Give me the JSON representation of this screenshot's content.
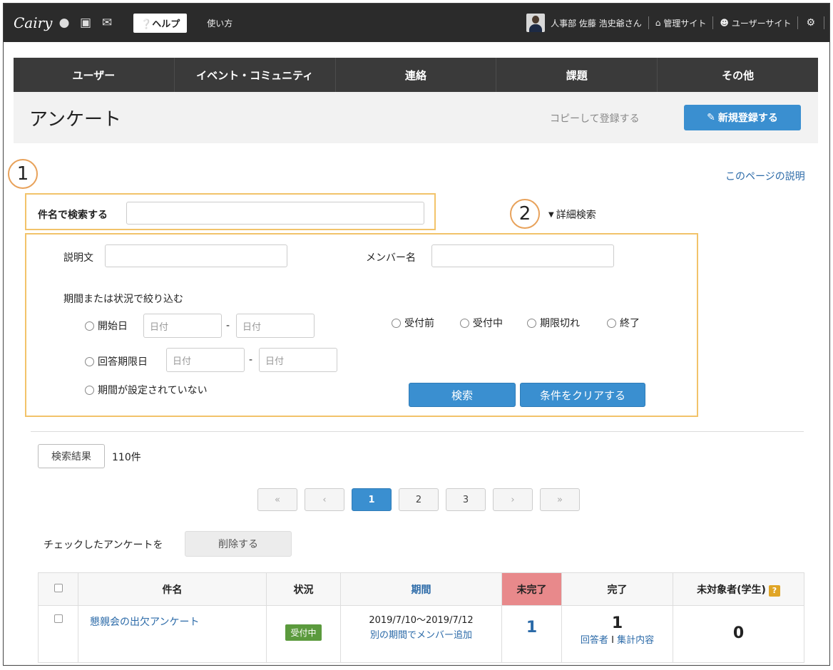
{
  "topbar": {
    "logo": "Cairy",
    "help_label": "ヘルプ",
    "howto_label": "使い方",
    "user_label": "人事部 佐藤 浩史爺さん",
    "admin_site": "管理サイト",
    "user_site": "ユーザーサイト"
  },
  "nav": {
    "items": [
      "ユーザー",
      "イベント・コミュニティ",
      "連絡",
      "課題",
      "その他"
    ]
  },
  "header": {
    "title": "アンケート",
    "copy_label": "コピーして登録する",
    "new_label": "新規登録する"
  },
  "annotations": {
    "one": "1",
    "two": "2"
  },
  "page_help": "このページの説明",
  "search": {
    "title_label": "件名で検索する",
    "title_value": "",
    "advanced_label": "詳細検索",
    "description_label": "説明文",
    "description_value": "",
    "member_label": "メンバー名",
    "member_value": "",
    "filter_heading": "期間または状況で絞り込む",
    "start_label": "開始日",
    "deadline_label": "回答期限日",
    "no_period_label": "期間が設定されていない",
    "date_placeholder": "日付",
    "date_sep": "-",
    "status_options": [
      "受付前",
      "受付中",
      "期限切れ",
      "終了"
    ],
    "search_button": "検索",
    "clear_button": "条件をクリアする"
  },
  "results": {
    "tag": "検索結果",
    "count": "110件"
  },
  "pagination": {
    "first": "«",
    "prev": "‹",
    "pages": [
      "1",
      "2",
      "3"
    ],
    "next": "›",
    "last": "»",
    "current": "1"
  },
  "bulk": {
    "label": "チェックしたアンケートを",
    "delete_button": "削除する"
  },
  "table": {
    "headers": {
      "title": "件名",
      "status": "状況",
      "period": "期間",
      "incomplete": "未完了",
      "complete": "完了",
      "excluded": "未対象者(学生)",
      "help_icon": "?"
    },
    "rows": [
      {
        "title": "懇親会の出欠アンケート",
        "status": "受付中",
        "period": "2019/7/10〜2019/7/12",
        "period_link": "別の期間でメンバー追加",
        "incomplete": "1",
        "complete": "1",
        "respondents_link": "回答者",
        "links_sep": "I",
        "summary_link": "集計内容",
        "excluded": "0"
      }
    ]
  },
  "colors": {
    "topbar": "#2b2b2b",
    "nav": "#3a3a3a",
    "primary": "#3a8fd0",
    "link": "#2b6aa8",
    "highlight_box": "#f2c36a",
    "annotation_circle": "#e8a25b",
    "incomplete_header": "#e8898b",
    "status_badge": "#5b9a3d"
  }
}
